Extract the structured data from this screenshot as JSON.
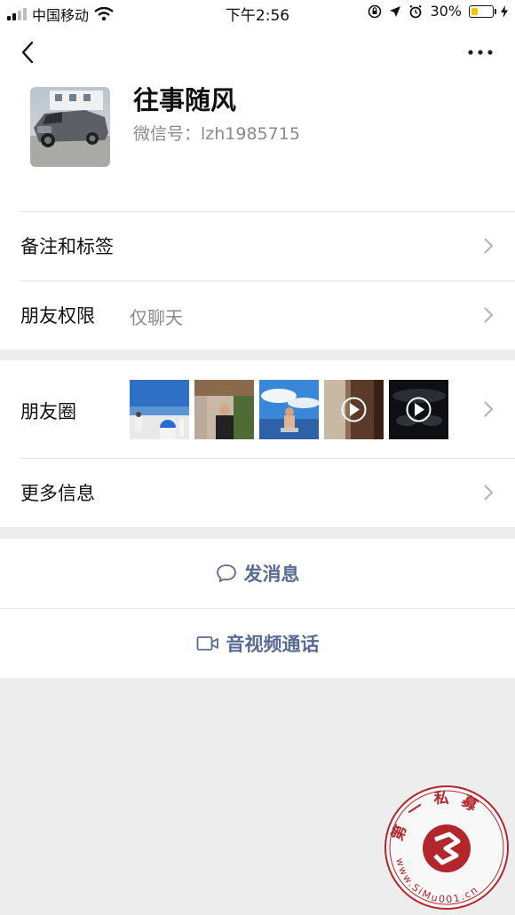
{
  "status_bar": {
    "carrier": "中国移动",
    "time": "下午2:56",
    "battery_text": "30%",
    "battery_level": 0.3,
    "icons": [
      "signal-icon",
      "wifi-icon",
      "rotation-lock-icon",
      "location-icon",
      "alarm-icon",
      "battery-icon",
      "charging-icon"
    ]
  },
  "profile": {
    "name": "往事随风",
    "wechat_id": "微信号：lzh1985715"
  },
  "rows": {
    "remark_label": "备注和标签",
    "permission_label": "朋友权限",
    "permission_value": "仅聊天",
    "moments_label": "朋友圈",
    "more_info_label": "更多信息"
  },
  "moments_thumbs": [
    {
      "desc": "photo",
      "video": false
    },
    {
      "desc": "photo",
      "video": false
    },
    {
      "desc": "photo",
      "video": false
    },
    {
      "desc": "video",
      "video": true
    },
    {
      "desc": "video",
      "video": true
    }
  ],
  "actions": {
    "message": "发消息",
    "video_call": "音视频通话"
  },
  "watermark": {
    "text": "第一私募 www.SiMu001.cn"
  },
  "colors": {
    "link": "#576b95",
    "background": "#ededed",
    "battery": "#f5c400",
    "watermark": "#b3262c"
  }
}
